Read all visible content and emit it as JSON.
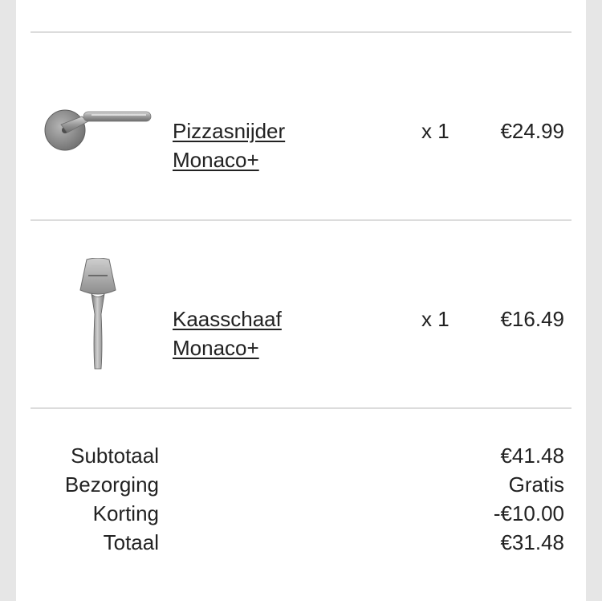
{
  "items": [
    {
      "name_line1": "Pizzasnijder",
      "name_line2": "Monaco+",
      "qty": "x 1",
      "price": "€24.99",
      "icon": "pizza-cutter-icon"
    },
    {
      "name_line1": "Kaasschaaf",
      "name_line2": "Monaco+",
      "qty": "x 1",
      "price": "€16.49",
      "icon": "cheese-slicer-icon"
    }
  ],
  "summary": {
    "subtotal_label": "Subtotaal",
    "subtotal_value": "€41.48",
    "shipping_label": "Bezorging",
    "shipping_value": "Gratis",
    "discount_label": "Korting",
    "discount_value": "-€10.00",
    "total_label": "Totaal",
    "total_value": "€31.48"
  }
}
